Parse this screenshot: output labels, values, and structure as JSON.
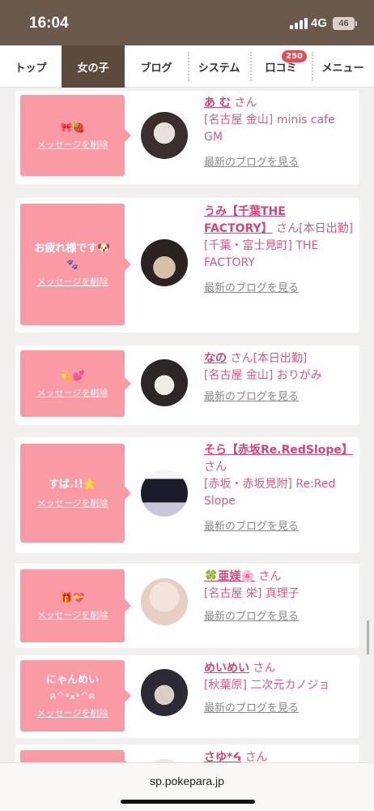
{
  "status": {
    "time": "16:04",
    "network": "4G",
    "battery": "46"
  },
  "nav": {
    "tabs": [
      {
        "label": "トップ",
        "active": false
      },
      {
        "label": "女の子",
        "active": true
      },
      {
        "label": "ブログ",
        "active": false
      },
      {
        "label": "システム",
        "active": false
      },
      {
        "label": "口コミ",
        "active": false,
        "badge": "250"
      },
      {
        "label": "メニュー",
        "active": false
      }
    ]
  },
  "delete_label": "メッセージを削除",
  "blog_label": "最新のブログを見る",
  "san": "さん",
  "cards": [
    {
      "message": "",
      "message_emoji": "🎀🍓",
      "name": "あ む",
      "suffix": "",
      "shop": "[名古屋 金山] minis cafe GM",
      "colors": [
        "#3a2f2e",
        "#e9e2dc"
      ]
    },
    {
      "message": "お疲れ様です🐶",
      "message_emoji": "🐾",
      "name": "うみ【千葉THE FACTORY】",
      "suffix": "[本日出勤]",
      "shop": "[千葉・富士見町] THE FACTORY",
      "colors": [
        "#2a2322",
        "#d7c0a8"
      ]
    },
    {
      "message": "",
      "message_emoji": "💫💕",
      "name": "なの",
      "suffix": "[本日出勤]",
      "shop": "[名古屋 金山] おりがみ",
      "colors": [
        "#2c2626",
        "#f0ede9"
      ]
    },
    {
      "message": "すば.!!⭐️",
      "message_emoji": "",
      "name": "そら【赤坂Re.RedSlope】",
      "suffix": "",
      "shop": "[赤坂・赤坂見附] Re:Red Slope",
      "colors": [
        "#1c1b2e",
        "#f4f4f4"
      ]
    },
    {
      "message": "",
      "message_emoji": "🎁💝",
      "name": "🍀亜媄🌸",
      "suffix": "",
      "shop": "[名古屋 栄] 真理子",
      "colors": [
        "#e8cfc4",
        "#f2e3dc"
      ]
    },
    {
      "message": "にゃんめい",
      "message_emoji": "ฅ^•ﻌ•^ฅ",
      "name": "めいめい",
      "suffix": "",
      "shop": "[秋葉原] 二次元カノジョ",
      "colors": [
        "#2b2a35",
        "#d9cfc7"
      ]
    },
    {
      "message": "",
      "message_emoji": "",
      "name": "さゆ*ᔦ",
      "suffix": "",
      "shop": "",
      "colors": [
        "#ece6e2",
        "#f5f0ec"
      ]
    }
  ],
  "url": "sp.pokepara.jp"
}
